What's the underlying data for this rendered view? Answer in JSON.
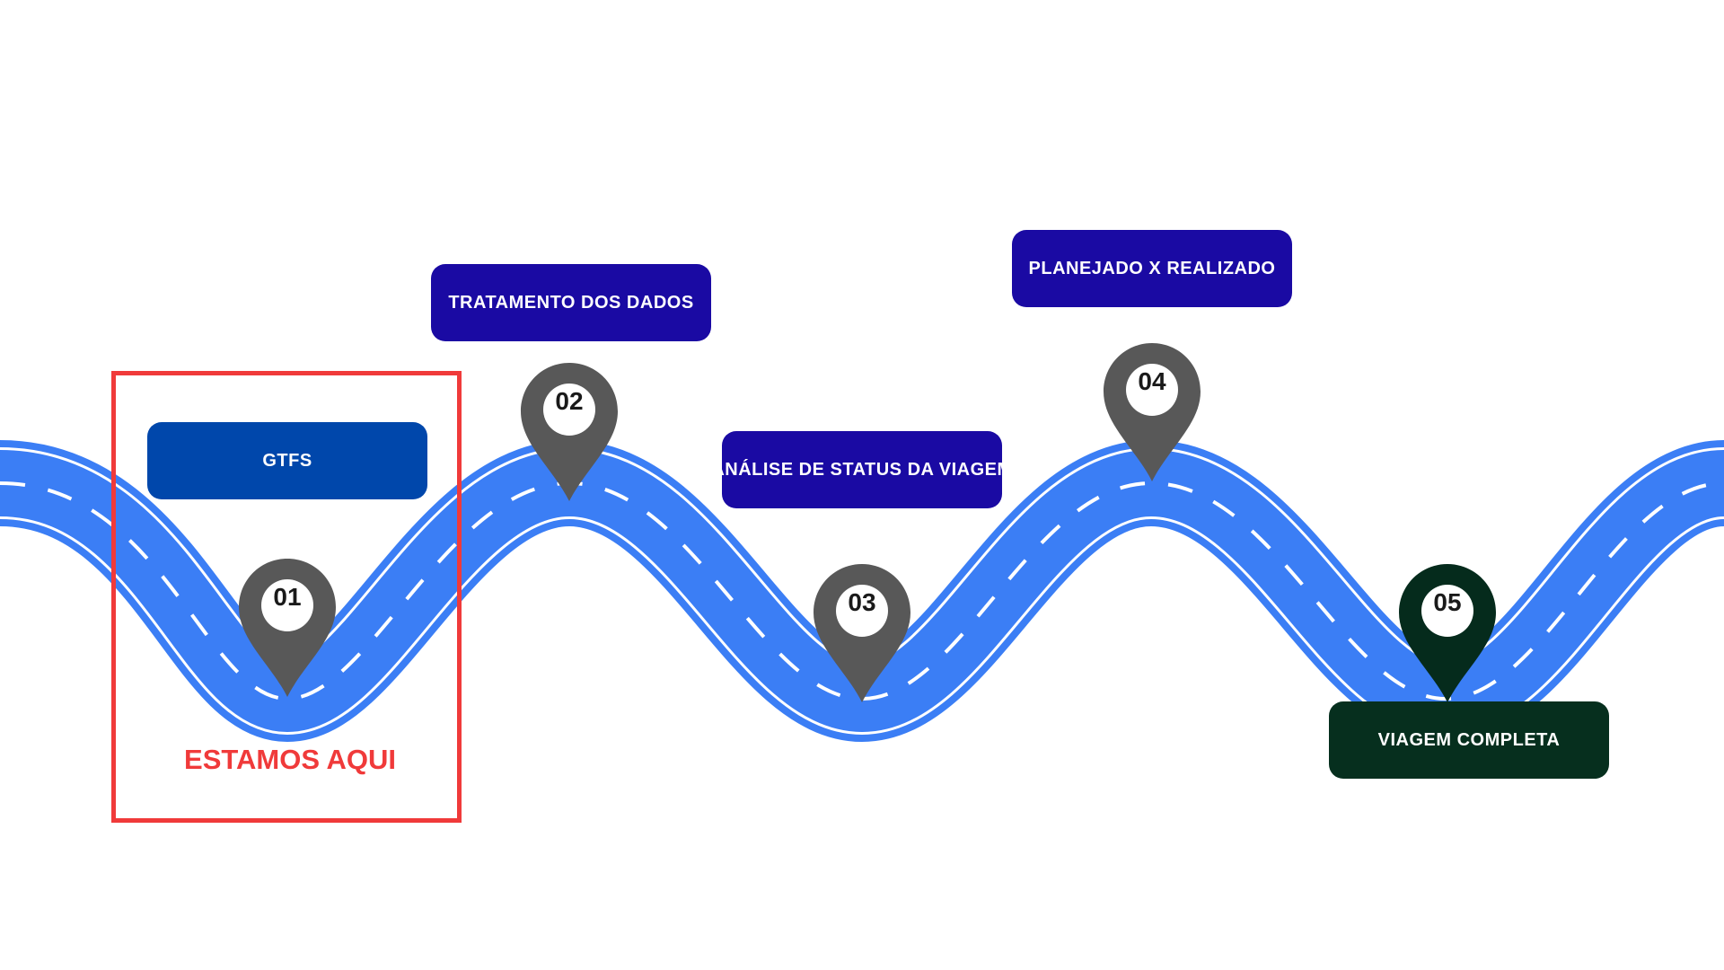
{
  "colors": {
    "road": "#3b7ef5",
    "road_edge": "#ffffff",
    "pin": "#585858",
    "pin_final": "#052b1c",
    "stage1": "#0047ab",
    "stage_mid": "#1a0aa3",
    "stage_final": "#062f1e",
    "highlight": "#f03a3a"
  },
  "stages": [
    {
      "number": "01",
      "label": "GTFS"
    },
    {
      "number": "02",
      "label": "TRATAMENTO DOS DADOS"
    },
    {
      "number": "03",
      "label": "ANÁLISE DE STATUS DA VIAGEM"
    },
    {
      "number": "04",
      "label": "PLANEJADO X REALIZADO"
    },
    {
      "number": "05",
      "label": "VIAGEM COMPLETA"
    }
  ],
  "current_marker": {
    "label": "ESTAMOS AQUI"
  }
}
